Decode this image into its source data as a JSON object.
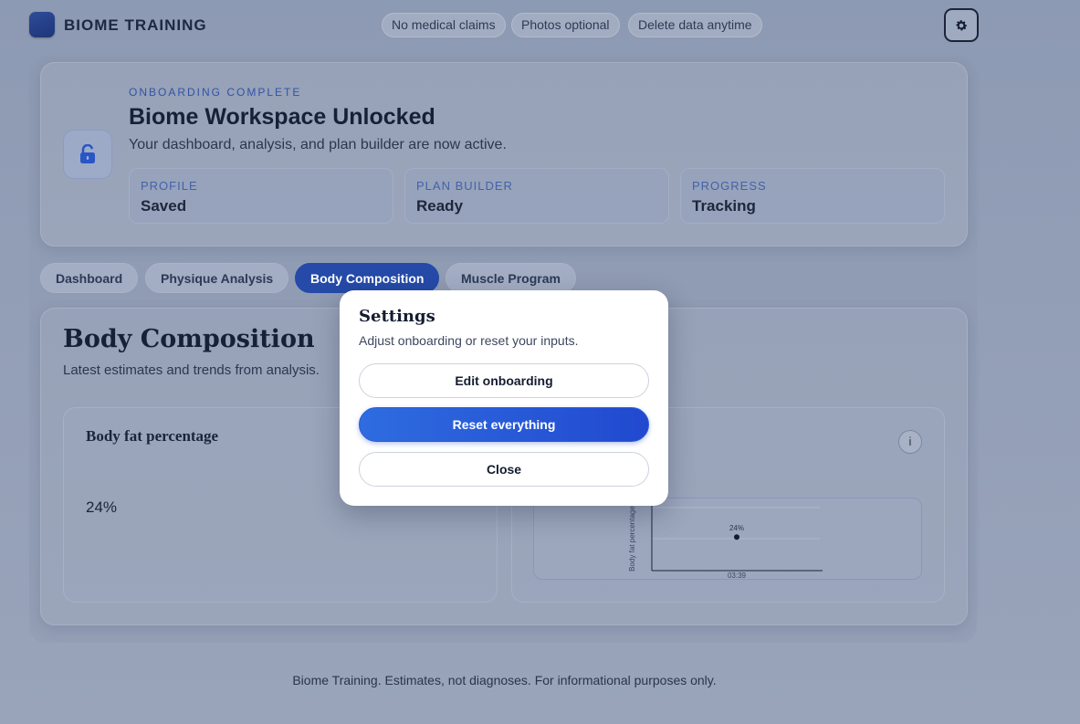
{
  "brand": {
    "name": "BIOME TRAINING"
  },
  "chips": [
    "No medical claims",
    "Photos optional",
    "Delete data anytime"
  ],
  "hero": {
    "eyebrow": "ONBOARDING COMPLETE",
    "title": "Biome Workspace Unlocked",
    "subtitle": "Your dashboard, analysis, and plan builder are now active.",
    "stats": [
      {
        "label": "PROFILE",
        "value": "Saved"
      },
      {
        "label": "PLAN BUILDER",
        "value": "Ready"
      },
      {
        "label": "PROGRESS",
        "value": "Tracking"
      }
    ]
  },
  "tabs": [
    {
      "label": "Dashboard",
      "active": false
    },
    {
      "label": "Physique Analysis",
      "active": false
    },
    {
      "label": "Body Composition",
      "active": true
    },
    {
      "label": "Muscle Program",
      "active": false
    }
  ],
  "section": {
    "title": "Body Composition",
    "subtitle": "Latest estimates and trends from analysis.",
    "panel_title": "Body fat percentage",
    "metric_value": "24%",
    "info_label": "i"
  },
  "chart_data": {
    "type": "scatter",
    "x": [
      "03:39"
    ],
    "y": [
      24
    ],
    "point_labels": [
      "24%"
    ],
    "ylabel": "Body fat percentage",
    "xlabel": ""
  },
  "modal": {
    "title": "Settings",
    "subtitle": "Adjust onboarding or reset your inputs.",
    "buttons": {
      "edit": "Edit onboarding",
      "reset": "Reset everything",
      "close": "Close"
    }
  },
  "footer": {
    "text": "Biome Training. Estimates, not diagnoses. For informational purposes only."
  },
  "colors": {
    "accent": "#254aa8",
    "primary_button": "#2f6ce0",
    "eyebrow": "#2f54a8"
  },
  "icons": {
    "settings": "gear-icon",
    "lock": "unlock-icon"
  }
}
